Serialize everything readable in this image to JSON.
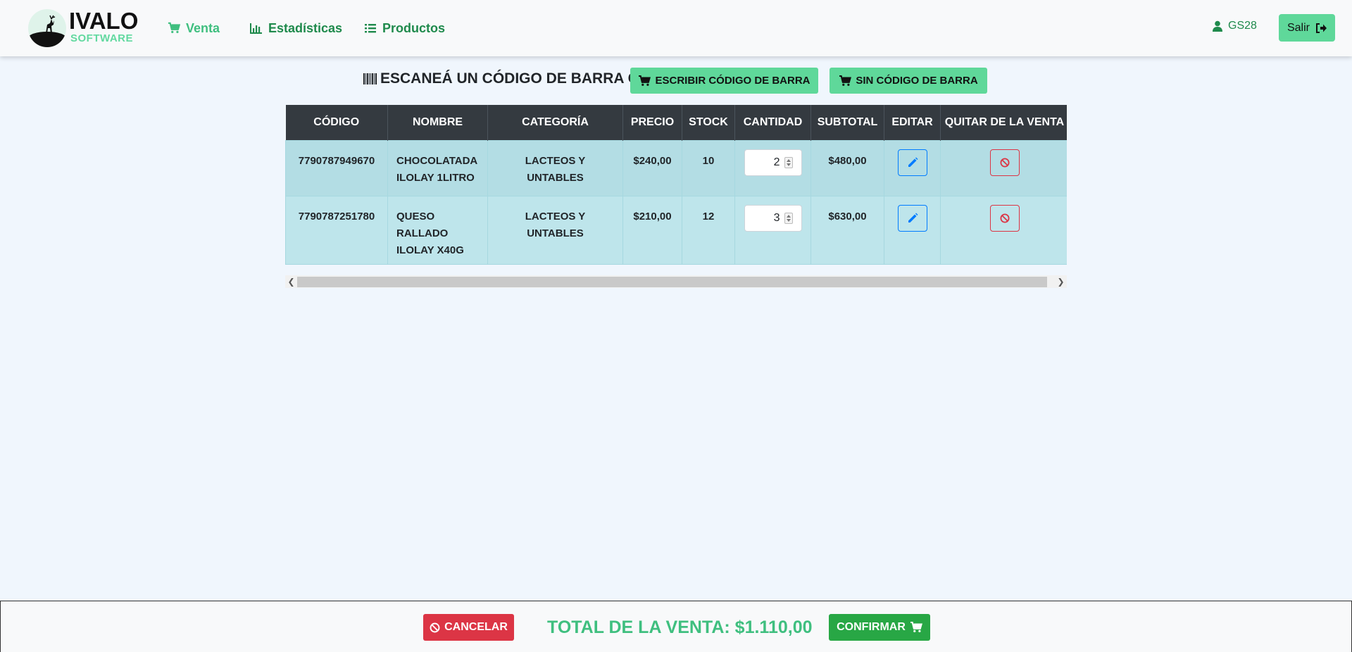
{
  "brand": {
    "title": "IVALO",
    "subtitle": "SOFTWARE"
  },
  "nav": {
    "items": [
      {
        "label": "Venta",
        "icon": "cart-icon",
        "active": true
      },
      {
        "label": "Estadísticas",
        "icon": "bar-chart-icon",
        "active": false
      },
      {
        "label": "Productos",
        "icon": "list-icon",
        "active": false
      }
    ],
    "user": "GS28",
    "logout_label": "Salir"
  },
  "scan": {
    "label": "ESCANEÁ UN CÓDIGO DE BARRA O:",
    "write_button": "ESCRIBIR CÓDIGO DE BARRA",
    "no_code_button": "SIN CÓDIGO DE BARRA"
  },
  "table": {
    "headers": [
      "CÓDIGO",
      "NOMBRE",
      "CATEGORÍA",
      "PRECIO",
      "STOCK",
      "CANTIDAD",
      "SUBTOTAL",
      "EDITAR",
      "QUITAR DE LA VENTA"
    ],
    "rows": [
      {
        "codigo": "7790787949670",
        "nombre": "CHOCOLATADA ILOLAY 1LITRO",
        "categoria": "LACTEOS Y UNTABLES",
        "precio": "$240,00",
        "stock": "10",
        "cantidad": "2",
        "subtotal": "$480,00"
      },
      {
        "codigo": "7790787251780",
        "nombre": "QUESO RALLADO ILOLAY X40G",
        "categoria": "LACTEOS Y UNTABLES",
        "precio": "$210,00",
        "stock": "12",
        "cantidad": "3",
        "subtotal": "$630,00"
      }
    ]
  },
  "footer": {
    "cancel_label": "CANCELAR",
    "total_label": "TOTAL DE LA VENTA: $1.110,00",
    "confirm_label": "CONFIRMAR"
  },
  "colors": {
    "accent_green": "#5fd89a",
    "nav_green": "#1f8a4c",
    "total_green": "#3fbf7f",
    "danger": "#dc3545",
    "primary": "#007bff",
    "header_dark": "#343a40"
  }
}
